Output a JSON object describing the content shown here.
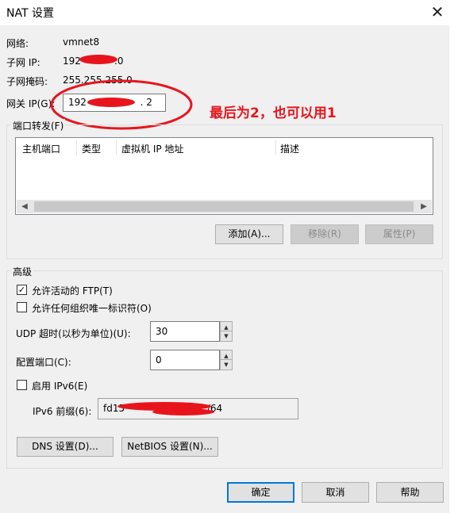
{
  "window": {
    "title": "NAT 设置",
    "close_glyph": "✕"
  },
  "network": {
    "network_label": "网络:",
    "network_value": "vmnet8",
    "subnet_ip_label": "子网 IP:",
    "subnet_ip_prefix": "192",
    "subnet_ip_suffix": ".0",
    "subnet_mask_label": "子网掩码:",
    "subnet_mask_value": "255.255.255.0",
    "gateway_label": "网关 IP(G):",
    "gateway_prefix": "192",
    "gateway_suffix": ". 2",
    "annotation": "最后为2，也可以用1"
  },
  "port_forwarding": {
    "group_label": "端口转发(F)",
    "columns": [
      "主机端口",
      "类型",
      "虚拟机 IP 地址",
      "描述"
    ],
    "rows": [],
    "add_button": "添加(A)...",
    "remove_button": "移除(R)",
    "properties_button": "属性(P)"
  },
  "advanced": {
    "group_label": "高级",
    "allow_active_ftp": {
      "label": "允许活动的 FTP(T)",
      "checked": true
    },
    "allow_any_oui": {
      "label": "允许任何组织唯一标识符(O)",
      "checked": false
    },
    "udp_timeout_label": "UDP 超时(以秒为单位)(U):",
    "udp_timeout_value": "30",
    "config_port_label": "配置端口(C):",
    "config_port_value": "0",
    "enable_ipv6": {
      "label": "启用 IPv6(E)",
      "checked": false
    },
    "ipv6_prefix_label": "IPv6 前缀(6):",
    "ipv6_prefix_value": "fd15",
    "ipv6_prefix_tail": ":/64",
    "dns_button": "DNS 设置(D)...",
    "netbios_button": "NetBIOS 设置(N)..."
  },
  "footer": {
    "ok": "确定",
    "cancel": "取消",
    "help": "帮助"
  },
  "colors": {
    "annotation": "#e8141c",
    "focus_border": "#0078d7"
  }
}
